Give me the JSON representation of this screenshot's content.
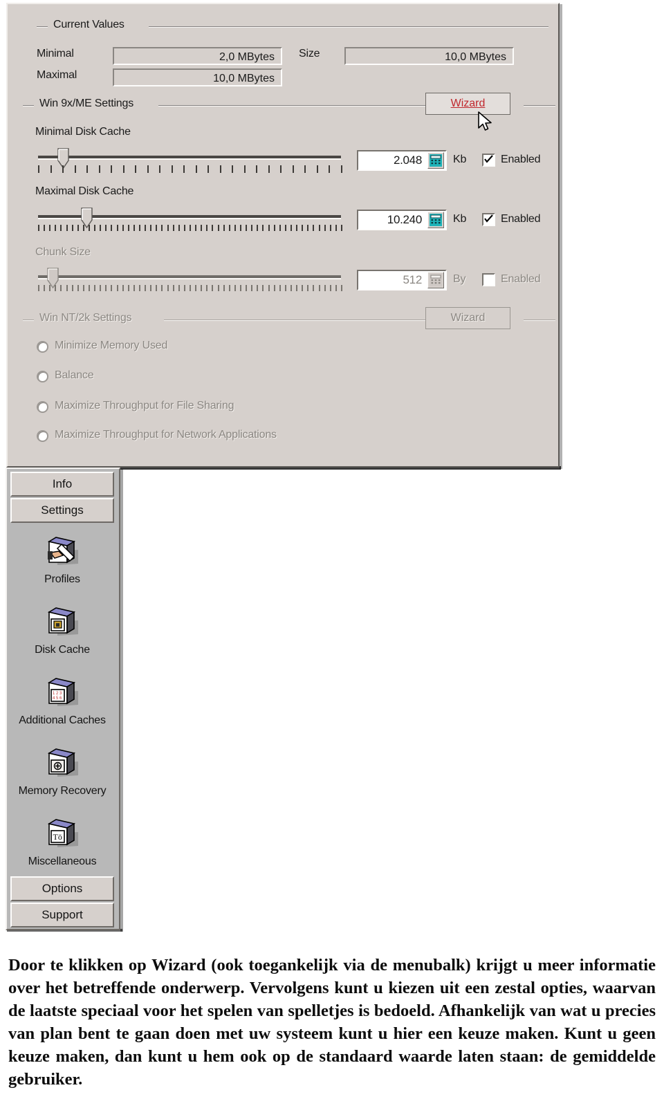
{
  "dialog": {
    "current_values": {
      "group_title": "Current Values",
      "minimal_label": "Minimal",
      "minimal_value": "2,0 MBytes",
      "maximal_label": "Maximal",
      "maximal_value": "10,0 MBytes",
      "size_label": "Size",
      "size_value": "10,0 MBytes"
    },
    "win9x": {
      "group_title": "Win 9x/ME Settings",
      "wizard_label": "Wizard",
      "rows": [
        {
          "label": "Minimal Disk Cache",
          "value": "2.048",
          "unit": "Kb",
          "enabled_label": "Enabled",
          "checked": true,
          "disabled": false,
          "thumb_pct": 7,
          "tick_count": 26,
          "tick_style": "wide"
        },
        {
          "label": "Maximal Disk Cache",
          "value": "10.240",
          "unit": "Kb",
          "enabled_label": "Enabled",
          "checked": true,
          "disabled": false,
          "thumb_pct": 15,
          "tick_count": 55,
          "tick_style": "narrow"
        },
        {
          "label": "Chunk Size",
          "value": "512",
          "unit": "By",
          "enabled_label": "Enabled",
          "checked": false,
          "disabled": true,
          "thumb_pct": 3,
          "tick_count": 55,
          "tick_style": "narrow"
        }
      ]
    },
    "winnt": {
      "group_title": "Win NT/2k Settings",
      "wizard_label": "Wizard",
      "disabled": true,
      "options": [
        {
          "label": "Minimize Memory Used",
          "selected": false
        },
        {
          "label": "Balance",
          "selected": false
        },
        {
          "label": "Maximize Throughput for File Sharing",
          "selected": false
        },
        {
          "label": "Maximize Throughput for Network Applications",
          "selected": false
        }
      ]
    }
  },
  "sidebar": {
    "top_buttons": [
      {
        "label": "Info"
      },
      {
        "label": "Settings"
      }
    ],
    "items": [
      {
        "label": "Profiles",
        "icon": "profiles-book-pencil-icon"
      },
      {
        "label": "Disk Cache",
        "icon": "disk-cache-book-icon"
      },
      {
        "label": "Additional Caches",
        "icon": "additional-caches-book-icon"
      },
      {
        "label": "Memory Recovery",
        "icon": "memory-recovery-book-icon"
      },
      {
        "label": "Miscellaneous",
        "icon": "miscellaneous-book-icon"
      }
    ],
    "bottom_buttons": [
      {
        "label": "Options"
      },
      {
        "label": "Support"
      }
    ]
  },
  "caption": {
    "text": "Door te klikken op Wizard (ook toegankelijk via de menubalk) krijgt u meer informatie over het betreffende onderwerp. Vervolgens kunt u kiezen uit een zestal opties, waarvan de laatste speciaal voor het spelen van spelletjes is bedoeld. Afhankelijk van wat u precies van plan bent te gaan doen met uw systeem kunt u hier een keuze maken. Kunt u geen keuze maken, dan kunt u hem ook op de standaard waarde laten staan: de gemiddelde gebruiker."
  },
  "colors": {
    "dialog_face": "#d6d0cc",
    "sidebar_face": "#b8b8b8",
    "wizard_link": "#c0272d",
    "disabled_text": "#8b8782",
    "text": "#1a1a1a"
  }
}
